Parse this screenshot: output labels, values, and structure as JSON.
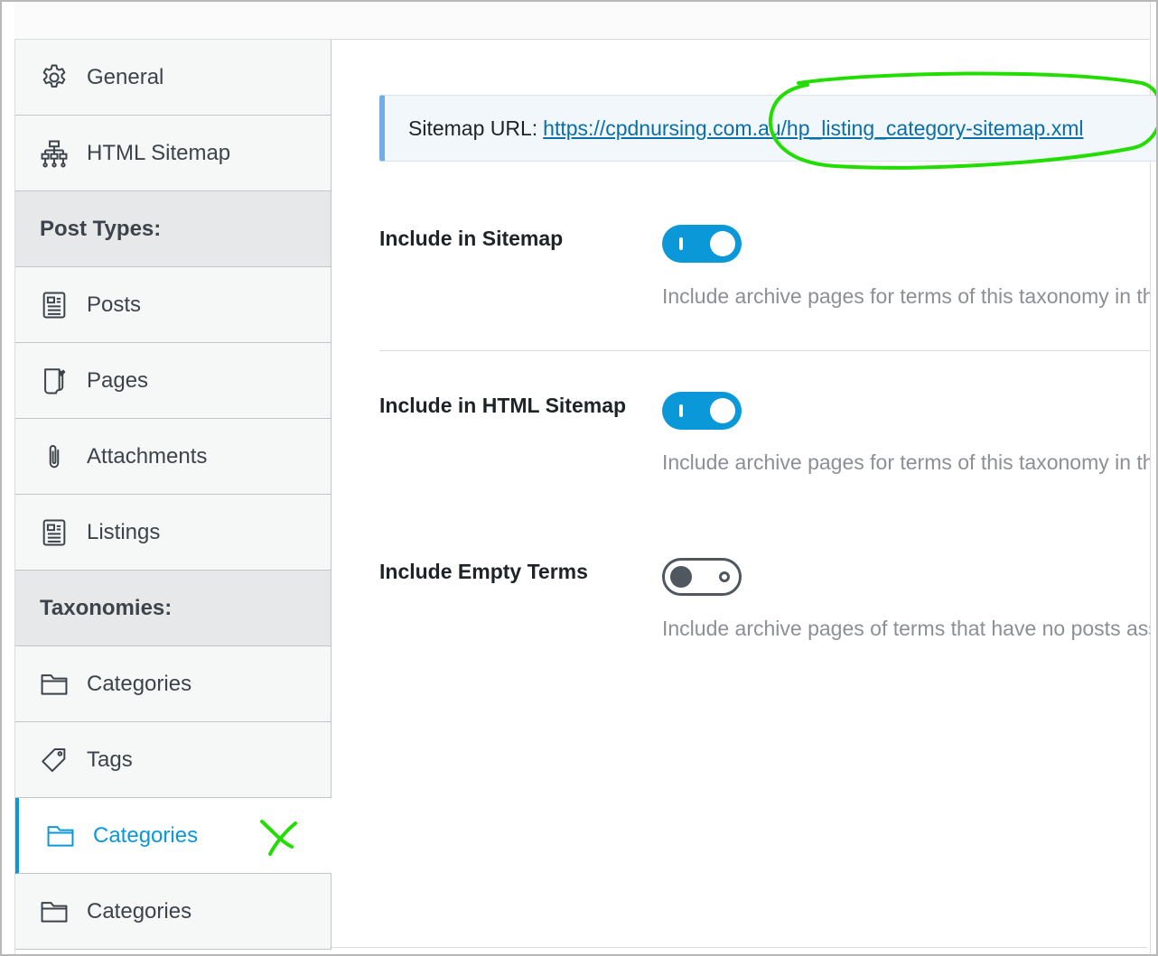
{
  "sidebar": {
    "general": {
      "label": "General",
      "icon": "gear-icon"
    },
    "html_sitemap": {
      "label": "HTML Sitemap",
      "icon": "sitemap-icon"
    },
    "post_types_heading": "Post Types:",
    "post_types": [
      {
        "label": "Posts",
        "icon": "document-icon"
      },
      {
        "label": "Pages",
        "icon": "page-icon"
      },
      {
        "label": "Attachments",
        "icon": "paperclip-icon"
      },
      {
        "label": "Listings",
        "icon": "document-icon"
      }
    ],
    "taxonomies_heading": "Taxonomies:",
    "taxonomies": [
      {
        "label": "Categories",
        "icon": "folder-icon"
      },
      {
        "label": "Tags",
        "icon": "tag-icon"
      },
      {
        "label": "Categories",
        "icon": "folder-icon",
        "active": true
      },
      {
        "label": "Categories",
        "icon": "folder-icon"
      }
    ]
  },
  "notice": {
    "prefix": "Sitemap URL:",
    "url": "https://cpdnursing.com.au/hp_listing_category-sitemap.xml"
  },
  "settings": [
    {
      "label": "Include in Sitemap",
      "enabled": true,
      "description": "Include archive pages for terms of this taxonomy in the XML sitemap."
    },
    {
      "label": "Include in HTML Sitemap",
      "enabled": true,
      "description": "Include archive pages for terms of this taxonomy in the HTML sitemap."
    },
    {
      "label": "Include Empty Terms",
      "enabled": false,
      "description": "Include archive pages of terms that have no posts associated."
    }
  ],
  "colors": {
    "accent": "#0b98d8",
    "annotation": "#22dd00",
    "link": "#0a6fa7",
    "notice_border": "#72aee6"
  }
}
